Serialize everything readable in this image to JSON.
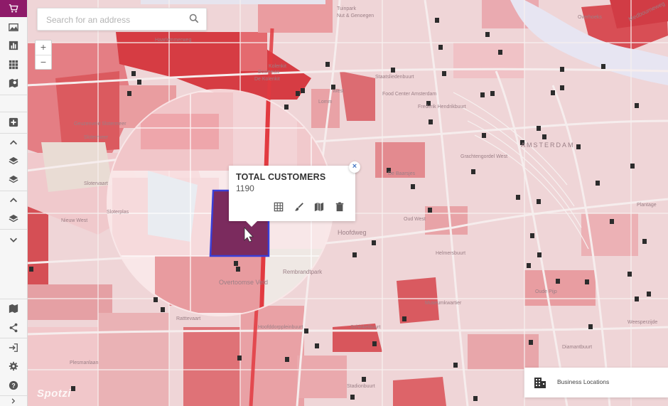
{
  "search": {
    "placeholder": "Search for an address"
  },
  "zoom": {
    "in_label": "+",
    "out_label": "−"
  },
  "popup": {
    "title": "TOTAL CUSTOMERS",
    "value": "1190",
    "close_label": "×"
  },
  "legend": {
    "label": "Business Locations"
  },
  "watermark": "Spotzi",
  "map_labels": [
    {
      "text": "Tuinpark",
      "name": "label-tuinpark"
    },
    {
      "text": "Nut & Genoegen",
      "name": "label-nut-genoegen"
    },
    {
      "text": "Overhoeks",
      "name": "label-overhoeks"
    },
    {
      "text": "Haarlemmerweg",
      "name": "label-haarlemmerweg"
    },
    {
      "text": "De Kolenkit",
      "name": "label-de-kolenkit"
    },
    {
      "text": "Bosleeuw",
      "name": "label-bosleeuw"
    },
    {
      "text": "Slotermeer",
      "name": "label-slotermeer"
    },
    {
      "text": "Geuzenveld Slotermeer",
      "name": "label-geuzenveld"
    },
    {
      "text": "Staatsliedenbuurt",
      "name": "label-staatsliedenbuurt"
    },
    {
      "text": "Food Center Amsterdam",
      "name": "label-food-center"
    },
    {
      "text": "Frederik Hendrikbuurt",
      "name": "label-frederik-hendrikbuurt"
    },
    {
      "text": "West",
      "name": "label-west"
    },
    {
      "text": "Lomm",
      "name": "label-lomm"
    },
    {
      "text": "AMSTERDAM",
      "name": "label-amsterdam"
    },
    {
      "text": "Grachtengordel West",
      "name": "label-grachtengordel"
    },
    {
      "text": "Slotervaart",
      "name": "label-slotervaart"
    },
    {
      "text": "Overtoomse Veld",
      "name": "label-overtoomse-veld"
    },
    {
      "text": "Kolenkit",
      "name": "label-kolenkit"
    },
    {
      "text": "Hoofdweg",
      "name": "label-hoofdweg"
    },
    {
      "text": "Museumkwartier",
      "name": "label-museumkwartier"
    },
    {
      "text": "Diamantbuurt",
      "name": "label-diamantbuurt"
    },
    {
      "text": "Plantage",
      "name": "label-plantage"
    },
    {
      "text": "Stadionbuurt",
      "name": "label-stadionbuurt"
    },
    {
      "text": "Hoofddorppleinbuurt",
      "name": "label-hoofddorpplein"
    },
    {
      "text": "Schinkelbuurt",
      "name": "label-schinkelbuurt"
    },
    {
      "text": "Nieuw West",
      "name": "label-nieuw-west"
    },
    {
      "text": "Sloterplas",
      "name": "label-sloterplas"
    },
    {
      "text": "De Baarsjes",
      "name": "label-de-baarsjes"
    },
    {
      "text": "Oud West",
      "name": "label-oud-west"
    },
    {
      "text": "Helmersbuurt",
      "name": "label-helmersbuurt"
    },
    {
      "text": "Rembrandtpark",
      "name": "label-rembrandtpark"
    },
    {
      "text": "Medbourneweg",
      "name": "label-medbourneweg"
    },
    {
      "text": "Plesmanlaan",
      "name": "label-plesmanlaan"
    },
    {
      "text": "Ratttevaart",
      "name": "label-rattevaart"
    },
    {
      "text": "Oude Pijp",
      "name": "label-oude-pijp"
    },
    {
      "text": "Weesperzijde",
      "name": "label-weesperzijde"
    }
  ],
  "colors": {
    "sidebar_accent": "#8e1b69",
    "choropleth_dark": "#d53d43",
    "choropleth_mid": "#e58b8f",
    "choropleth_light": "#f3cfd3",
    "highlight_fill": "#7b2b5e",
    "highlight_border": "#3a3fd8"
  },
  "sidebar_icons": [
    "cart-icon",
    "image-icon",
    "bar-chart-icon",
    "grid-icon",
    "map-pin-icon",
    "add-icon",
    "chevron-up-icon",
    "layers-icon",
    "layers-icon",
    "chevron-up-icon",
    "layers-icon",
    "chevron-down-icon",
    "map-icon",
    "share-icon",
    "sign-in-icon",
    "gear-icon",
    "help-icon",
    "chevron-right-icon"
  ]
}
